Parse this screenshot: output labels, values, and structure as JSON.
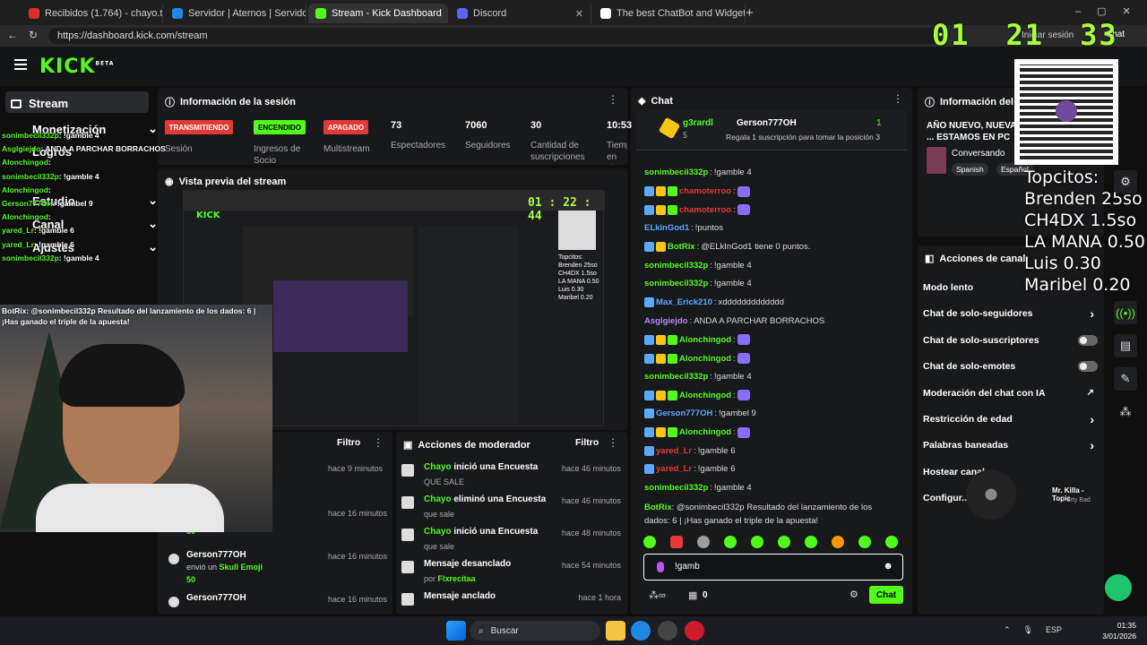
{
  "browser": {
    "tabs": [
      {
        "label": "Recibidos (1.764) - chayo.tube.18@",
        "color": "#d93025"
      },
      {
        "label": "Servidor | Aternos | Servidor de Mi",
        "color": "#1e88e5"
      },
      {
        "label": "Stream - Kick Dashboard",
        "color": "#53fc18"
      },
      {
        "label": "Discord",
        "color": "#5865f2"
      },
      {
        "label": "The best ChatBot and Widgets for",
        "color": "#ffffff"
      }
    ],
    "url": "https://dashboard.kick.com/stream",
    "signin": "Iniciar sesión",
    "chat_btn": "Chat",
    "clock_overlay": [
      "01",
      "21",
      "33"
    ]
  },
  "app": {
    "logo": "KICK",
    "logo_beta": "BETA",
    "sidebar": {
      "stream": "Stream",
      "monetization": "Monetización",
      "logros": "Logros",
      "estudio": "Estudio",
      "canal": "Canal",
      "ajustes": "Ajustes"
    }
  },
  "session": {
    "title": "Información de la sesión",
    "chips": [
      {
        "label": "TRANSMITIENDO",
        "bg": "#e53935",
        "fg": "#ffffff"
      },
      {
        "label": "ENCENDIDO",
        "bg": "#53fc18",
        "fg": "#000000"
      },
      {
        "label": "APAGADO",
        "bg": "#e53935",
        "fg": "#ffffff"
      }
    ],
    "chip_labels": [
      "Sesión",
      "Ingresos de Socio",
      "Multistream"
    ],
    "stats": [
      {
        "value": "73",
        "label": "Espectadores"
      },
      {
        "value": "7060",
        "label": "Seguidores"
      },
      {
        "value": "30",
        "label": "Cantidad de suscripciones"
      },
      {
        "value": "10:53",
        "label": "Tiempo en vivo"
      }
    ]
  },
  "preview": {
    "title": "Vista previa del stream",
    "timer": [
      "01",
      "22",
      "44"
    ]
  },
  "activity": {
    "filter": "Filtro",
    "items": [
      {
        "time": "hace 9 minutos"
      },
      {
        "time": "hace 16 minutos",
        "count": "50"
      },
      {
        "user": "Gerson777OH",
        "text": "envió un",
        "emote": "Skull Emoji",
        "count": "50",
        "time": "hace 16 minutos"
      },
      {
        "user": "Gerson777OH",
        "time": "hace 16 minutos"
      }
    ]
  },
  "mod_actions": {
    "title": "Acciones de moderador",
    "filter": "Filtro",
    "rows": [
      {
        "who": "Chayo",
        "action": "inició una Encuesta",
        "sub": "QUE SALE",
        "time": "hace 46 minutos"
      },
      {
        "who": "Chayo",
        "action": "eliminó una Encuesta",
        "sub": "que sale",
        "time": "hace 46 minutos"
      },
      {
        "who": "Chayo",
        "action": "inició una Encuesta",
        "sub": "que sale",
        "time": "hace 48 minutos"
      },
      {
        "who": "",
        "action": "Mensaje desanclado",
        "sub_prefix": "por",
        "sub_user": "Flxrecitaa",
        "time": "hace 54 minutos"
      },
      {
        "who": "",
        "action": "Mensaje anclado",
        "sub": "",
        "time": "hace 1 hora"
      }
    ]
  },
  "chat": {
    "title": "Chat",
    "pinned": {
      "user": "g3rardl",
      "count": "5",
      "gifter": "Gerson777OH",
      "gift_count": "1",
      "gift_text": "Regala 1 suscripción para tomar la posición 3"
    },
    "messages": [
      {
        "user": "sonimbecil332p",
        "cls": "u-green",
        "text": "!gamble 4",
        "badges": 0
      },
      {
        "user": "chamoterroo",
        "cls": "u-red",
        "text": "",
        "badges": 3
      },
      {
        "user": "chamoterroo",
        "cls": "u-red",
        "text": "",
        "badges": 3
      },
      {
        "user": "ELkInGod1",
        "cls": "u-blue",
        "text": "!puntos",
        "badges": 0
      },
      {
        "user": "BotRix",
        "cls": "u-green",
        "text": "@ELkInGod1 tiene 0 puntos.",
        "badges": 2
      },
      {
        "user": "sonimbecil332p",
        "cls": "u-green",
        "text": "!gamble 4",
        "badges": 0
      },
      {
        "user": "sonimbecil332p",
        "cls": "u-green",
        "text": "!gamble 4",
        "badges": 0
      },
      {
        "user": "Max_Erick210",
        "cls": "u-blue",
        "text": "xddddddddddddd",
        "badges": 1
      },
      {
        "user": "Asglgiejdo",
        "cls": "u-purple",
        "text": "ANDA A PARCHAR BORRACHOS",
        "badges": 0
      },
      {
        "user": "Alonchingod",
        "cls": "u-green",
        "text": "",
        "badges": 3
      },
      {
        "user": "Alonchingod",
        "cls": "u-green",
        "text": "",
        "badges": 3
      },
      {
        "user": "sonimbecil332p",
        "cls": "u-green",
        "text": "!gamble 4",
        "badges": 0
      },
      {
        "user": "Alonchingod",
        "cls": "u-green",
        "text": "",
        "badges": 3
      },
      {
        "user": "Gerson777OH",
        "cls": "u-blue",
        "text": "!gambel 9",
        "badges": 1
      },
      {
        "user": "Alonchingod",
        "cls": "u-green",
        "text": "",
        "badges": 3
      },
      {
        "user": "yared_Lr",
        "cls": "u-red",
        "text": "!gamble 6",
        "badges": 1
      },
      {
        "user": "yared_Lr",
        "cls": "u-red",
        "text": "!gamble 6",
        "badges": 1
      },
      {
        "user": "sonimbecil332p",
        "cls": "u-green",
        "text": "!gamble 4",
        "badges": 0
      }
    ],
    "last_msg": {
      "user": "BotRix",
      "text": "@sonimbecil332p Resultado del lanzamiento de los",
      "text2": "dados: 6 | ¡Has ganado el triple de la apuesta!"
    },
    "input_value": "!gamb",
    "footer_count": "0",
    "send": "Chat"
  },
  "stream_info": {
    "title": "Información del stream",
    "desc": "AÑO NUEVO, NUEVA ... ESTAMOS EN PC",
    "category": "Conversando",
    "lang": [
      "Spanish",
      "Español"
    ]
  },
  "channel_actions": {
    "title": "Acciones de canal",
    "rows": [
      {
        "label": "Modo lento",
        "type": "none"
      },
      {
        "label": "Chat de solo-seguidores",
        "type": "arrow"
      },
      {
        "label": "Chat de solo-suscriptores",
        "type": "toggle"
      },
      {
        "label": "Chat de solo-emotes",
        "type": "toggle"
      },
      {
        "label": "Moderación del chat con IA",
        "type": "ext"
      },
      {
        "label": "Restricción de edad",
        "type": "arrow"
      },
      {
        "label": "Palabras baneadas",
        "type": "arrow"
      },
      {
        "label": "Hostear canal",
        "type": "none"
      },
      {
        "label": "Configur...",
        "type": "none"
      }
    ]
  },
  "overlay_list": [
    "Topcitos:",
    "Brenden 25so",
    "CH4DX 1.5so",
    "LA MANA 0.50",
    "Luis 0.30",
    "Maribel 0.20"
  ],
  "music": {
    "title": "Mr. Killa - Topic",
    "sub": "Party Bad"
  },
  "overlay_chat": [
    {
      "user": "sonimbecil332p",
      "text": ": !gamble 4"
    },
    {
      "user": "Asglgiejdo",
      "text": ": ANDA A PARCHAR BORRACHOS"
    },
    {
      "user": "Alonchingod",
      "text": ":"
    },
    {
      "user": "sonimbecil332p",
      "text": ": !gamble 4"
    },
    {
      "user": "Alonchingod",
      "text": ":"
    },
    {
      "user": "Gerson777OH",
      "text": ": !gambel 9"
    },
    {
      "user": "Alonchingod",
      "text": ":"
    },
    {
      "user": "yared_Lr",
      "text": ": !gamble 6"
    },
    {
      "user": "yared_Lr",
      "text": ": !gamble 6"
    },
    {
      "user": "sonimbecil332p",
      "text": ": !gamble 4"
    }
  ],
  "overlay_bot": "BotRix: @sonimbecil332p Resultado del lanzamiento de los dados: 6 | ¡Has ganado el triple de la apuesta!",
  "taskbar": {
    "search": "Buscar",
    "lang": "ESP",
    "time": "01:35",
    "date": "3/01/2026"
  }
}
